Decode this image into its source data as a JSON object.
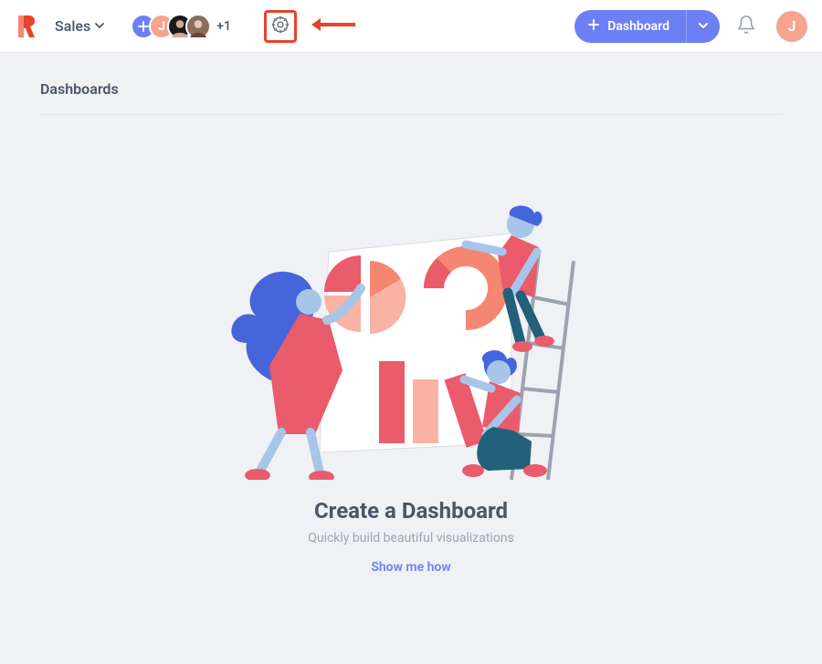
{
  "header": {
    "workspace_name": "Sales",
    "avatar_overflow": "+1",
    "add_avatar_icon": "plus-icon",
    "user_initial": "J",
    "dashboard_button_label": "Dashboard"
  },
  "main": {
    "section_title": "Dashboards",
    "empty_state": {
      "title": "Create a Dashboard",
      "subtitle": "Quickly build beautiful visualizations",
      "cta": "Show me how"
    }
  },
  "colors": {
    "accent": "#6d7ff5",
    "highlight": "#e8422b",
    "avatar_peach": "#f5a58f"
  }
}
